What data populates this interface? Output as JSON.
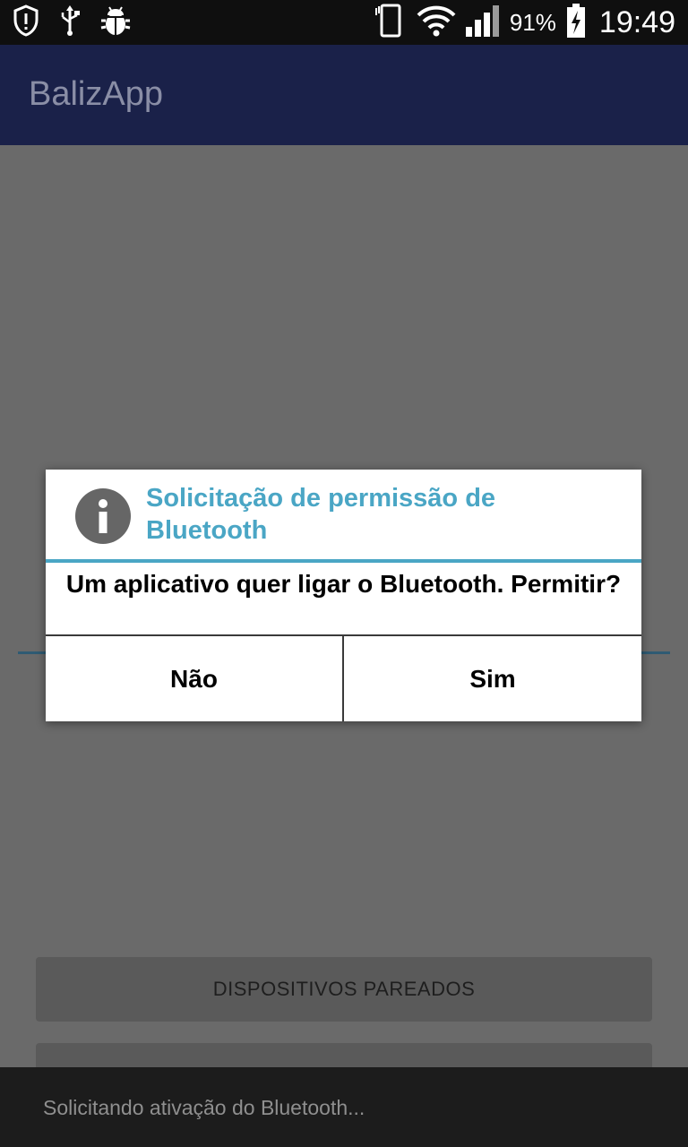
{
  "status_bar": {
    "battery_percent": "91%",
    "time": "19:49",
    "icons": [
      "shield-alert-icon",
      "usb-icon",
      "android-debug-icon",
      "vibrate-icon",
      "wifi-icon",
      "signal-icon",
      "battery-charging-icon"
    ]
  },
  "app_bar": {
    "title": "BalizApp"
  },
  "background": {
    "button_paired": "DISPOSITIVOS PAREADOS"
  },
  "dialog": {
    "icon": "info-icon",
    "title": "Solicitação de permissão de Bluetooth",
    "message": "Um aplicativo quer ligar o Bluetooth. Permitir?",
    "negative_label": "Não",
    "positive_label": "Sim"
  },
  "toast": {
    "text": "Solicitando ativação do Bluetooth..."
  },
  "colors": {
    "accent": "#4aa6c5",
    "app_bar": "#1a2149",
    "scrim_background": "#6a6a6a"
  }
}
